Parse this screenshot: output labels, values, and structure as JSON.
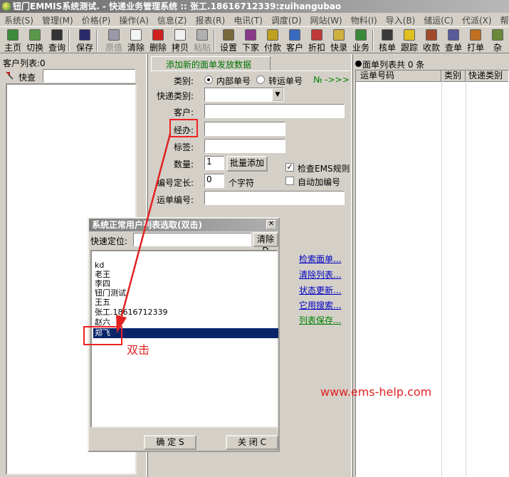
{
  "window": {
    "title": "钮门EMMIS系统测试. - 快递业务管理系统 :: 张工.18616712339:zuihangubao"
  },
  "menu": [
    "系统(S)",
    "管理(M)",
    "价格(P)",
    "操作(A)",
    "信息(Z)",
    "报表(R)",
    "电讯(T)",
    "调度(D)",
    "网站(W)",
    "物料(I)",
    "导入(B)",
    "储运(C)",
    "代派(X)",
    "帮"
  ],
  "toolbar": [
    {
      "label": "主页",
      "icon": "home-icon",
      "color": "#3c8c3c"
    },
    {
      "label": "切换",
      "icon": "switch-icon",
      "color": "#5a9a4a"
    },
    {
      "label": "查询",
      "icon": "binoculars-icon",
      "color": "#333333"
    },
    {
      "label": "保存",
      "icon": "floppy-icon",
      "color": "#2a2a6a"
    },
    {
      "label": "原值",
      "icon": "restore-icon",
      "color": "#9a9aaa",
      "disabled": true
    },
    {
      "label": "清除",
      "icon": "page-icon",
      "color": "#f4f4f4"
    },
    {
      "label": "删除",
      "icon": "delete-icon",
      "color": "#d02020"
    },
    {
      "label": "拷贝",
      "icon": "copy-icon",
      "color": "#f0f0f0"
    },
    {
      "label": "粘贴",
      "icon": "paste-icon",
      "color": "#b0b0b0",
      "disabled": true
    },
    {
      "label": "设置",
      "icon": "settings-icon",
      "color": "#7a6a3a"
    },
    {
      "label": "下家",
      "icon": "next-icon",
      "color": "#8a3a8a"
    },
    {
      "label": "付款",
      "icon": "payment-icon",
      "color": "#c0a020"
    },
    {
      "label": "客户",
      "icon": "customers-icon",
      "color": "#3a6ac0"
    },
    {
      "label": "折扣",
      "icon": "discount-icon",
      "color": "#c03a3a"
    },
    {
      "label": "快录",
      "icon": "quick-entry-icon",
      "color": "#d0b040"
    },
    {
      "label": "业务",
      "icon": "business-icon",
      "color": "#3a8a3a"
    },
    {
      "label": "核单",
      "icon": "verify-icon",
      "color": "#3a3a3a"
    },
    {
      "label": "跟踪",
      "icon": "track-icon",
      "color": "#e0c020"
    },
    {
      "label": "收款",
      "icon": "receive-icon",
      "color": "#a04a2a"
    },
    {
      "label": "查单",
      "icon": "search-order-icon",
      "color": "#5a5a9a"
    },
    {
      "label": "打单",
      "icon": "print-icon",
      "color": "#c07020"
    },
    {
      "label": "杂",
      "icon": "misc-icon",
      "color": "#6a8a3a"
    }
  ],
  "left_panel": {
    "title": "客户列表:0",
    "search_label": "快查",
    "search_value": ""
  },
  "form": {
    "tab": "添加新的面单发放数据",
    "category_label": "类别:",
    "radio_internal": "内部单号",
    "radio_transfer": "转运单号",
    "no_hint": "№ ->>>",
    "express_type_label": "快递类别:",
    "express_type_value": "",
    "customer_label": "客户:",
    "customer_value": "",
    "handler_label": "经办:",
    "handler_value": "",
    "tag_label": "标签:",
    "tag_value": "",
    "quantity_label": "数量:",
    "quantity_value": "1",
    "batch_add": "批量添加",
    "check_ems": "检查EMS规则",
    "code_len_label": "编号定长:",
    "code_len_value": "0",
    "code_len_unit": "个字符",
    "auto_code": "自动加编号",
    "waybill_label": "运单编号:",
    "waybill_value": ""
  },
  "links": [
    "检索面单...",
    "清除列表...",
    "状态更新...",
    "它用搜索...",
    "列表保存..."
  ],
  "right_panel": {
    "title": "面单列表共 0 条",
    "columns": [
      "运单号码",
      "类别",
      "快递类别"
    ]
  },
  "dialog": {
    "title": "系统正常用户列表选取(双击)",
    "locate_label": "快速定位:",
    "locate_value": "",
    "clear_button": "清除D",
    "items": [
      "kd",
      "老王",
      "李四",
      "钮门测试",
      "王五",
      "张工.18616712339",
      "赵六",
      "郑飞"
    ],
    "selected_index": 7,
    "ok_button": "确  定 S",
    "close_button": "关  闭 C"
  },
  "annotation": {
    "double_click": "双击",
    "watermark": "www.ems-help.com",
    "color": "#e22222"
  }
}
